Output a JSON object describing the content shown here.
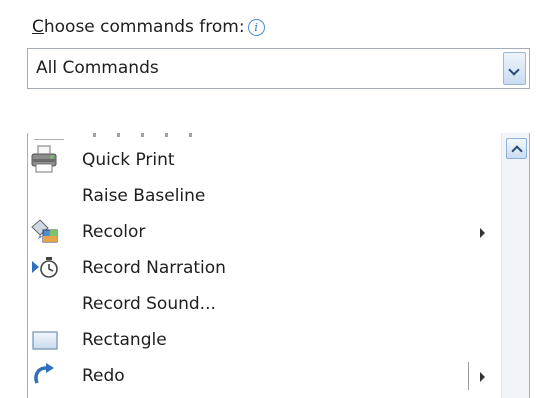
{
  "header": {
    "label_access_key": "C",
    "label_rest": "hoose commands from:",
    "info_icon": "info-icon"
  },
  "combo": {
    "selected": "All Commands",
    "icon": "chevron-down-icon"
  },
  "list": {
    "items": [
      {
        "label": "Quick Print",
        "icon": "printer-icon",
        "submenu": false,
        "split": false
      },
      {
        "label": "Raise Baseline",
        "icon": "",
        "submenu": false,
        "split": false
      },
      {
        "label": "Recolor",
        "icon": "recolor-icon",
        "submenu": true,
        "split": false
      },
      {
        "label": "Record Narration",
        "icon": "record-narration-icon",
        "submenu": false,
        "split": false
      },
      {
        "label": "Record Sound...",
        "icon": "",
        "submenu": false,
        "split": false
      },
      {
        "label": "Rectangle",
        "icon": "rectangle-icon",
        "submenu": false,
        "split": false
      },
      {
        "label": "Redo",
        "icon": "redo-icon",
        "submenu": true,
        "split": true
      }
    ],
    "scroll_up_icon": "chevron-up-icon"
  }
}
